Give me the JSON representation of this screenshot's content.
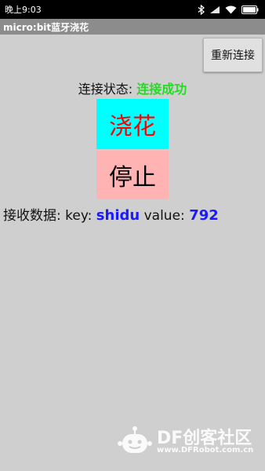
{
  "status_bar": {
    "time": "晚上9:03"
  },
  "app_bar": {
    "title": "micro:bit蓝牙浇花"
  },
  "reconnect_button": {
    "label": "重新连接"
  },
  "connection": {
    "label": "连接状态: ",
    "status": "连接成功",
    "status_color": "#22dd22"
  },
  "water_button": {
    "label": "浇花",
    "bg": "#00ffff",
    "fg": "#ff0000"
  },
  "stop_button": {
    "label": "停止",
    "bg": "#ffb3b3",
    "fg": "#000000"
  },
  "received": {
    "label": "接收数据: key: ",
    "key": "shidu",
    "value_label": " value: ",
    "value": "792"
  },
  "watermark": {
    "brand": "DF创客社区",
    "url": "www.DFRobot.com.cn"
  }
}
